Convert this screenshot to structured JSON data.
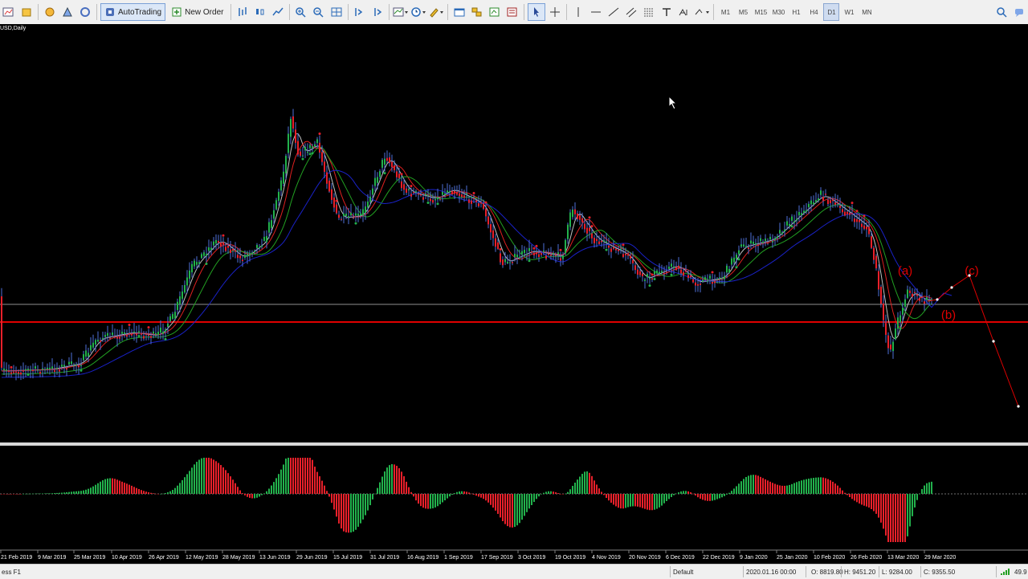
{
  "toolbar": {
    "autotrading_label": "AutoTrading",
    "new_order_label": "New Order",
    "timeframes": [
      "M1",
      "M5",
      "M15",
      "M30",
      "H1",
      "H4",
      "D1",
      "W1",
      "MN"
    ],
    "active_timeframe": "D1"
  },
  "chart": {
    "symbol_label": "USD,Daily",
    "date_labels": [
      "21 Feb 2019",
      "9 Mar 2019",
      "25 Mar 2019",
      "10 Apr 2019",
      "26 Apr 2019",
      "12 May 2019",
      "28 May 2019",
      "13 Jun 2019",
      "29 Jun 2019",
      "15 Jul 2019",
      "31 Jul 2019",
      "16 Aug 2019",
      "1 Sep 2019",
      "17 Sep 2019",
      "3 Oct 2019",
      "19 Oct 2019",
      "4 Nov 2019",
      "20 Nov 2019",
      "6 Dec 2019",
      "22 Dec 2019",
      "9 Jan 2020",
      "25 Jan 2020",
      "10 Feb 2020",
      "26 Feb 2020",
      "13 Mar 2020",
      "29 Mar 2020"
    ],
    "wave_labels": {
      "a": "(a)",
      "b": "(b)",
      "c": "(c)"
    },
    "colors": {
      "bull": "#22b14c",
      "bear": "#e8202a",
      "wick": "#4e6fd8",
      "ma_fast": "#c0c0c0",
      "ma_mid": "#e02020",
      "ma_slow": "#22a022",
      "ma_long": "#1a22c8",
      "support": "#e00000",
      "level": "#909090"
    }
  },
  "statusbar": {
    "help": "ess F1",
    "profile": "Default",
    "datetime": "2020.01.16 00:00",
    "open": "O: 8819.80",
    "high": "H: 9451.20",
    "low": "L: 9284.00",
    "close": "C: 9355.50",
    "traffic": "49.9"
  }
}
